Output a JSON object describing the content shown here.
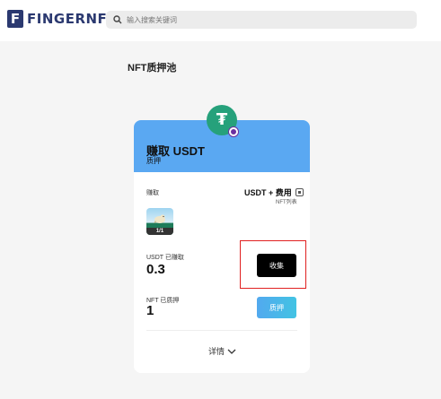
{
  "brand": {
    "mark": "F",
    "name": "FINGERNFT"
  },
  "search": {
    "placeholder": "输入搜索关键词",
    "value": ""
  },
  "page": {
    "title": "NFT质押池"
  },
  "pool_card": {
    "title": "赚取 USDT",
    "subtitle": "质押",
    "token_icon": "tether-icon",
    "token_glyph": "₮",
    "earn_label": "赚取",
    "reward": "USDT + 费用",
    "nft_list_label": "NFT列表",
    "nft_thumb_count": "1/1",
    "earned_label": "USDT 已赚取",
    "earned_value": "0.3",
    "collect_label": "收集",
    "staked_label": "NFT 已质押",
    "staked_value": "1",
    "stake_label": "质押",
    "details_label": "详情"
  },
  "colors": {
    "brand": "#2b3970",
    "card_header": "#5aa8f2",
    "tether_green": "#26a17b",
    "collect_button": "#000000",
    "stake_button": "#4cb6ea",
    "highlight": "#e02020"
  }
}
